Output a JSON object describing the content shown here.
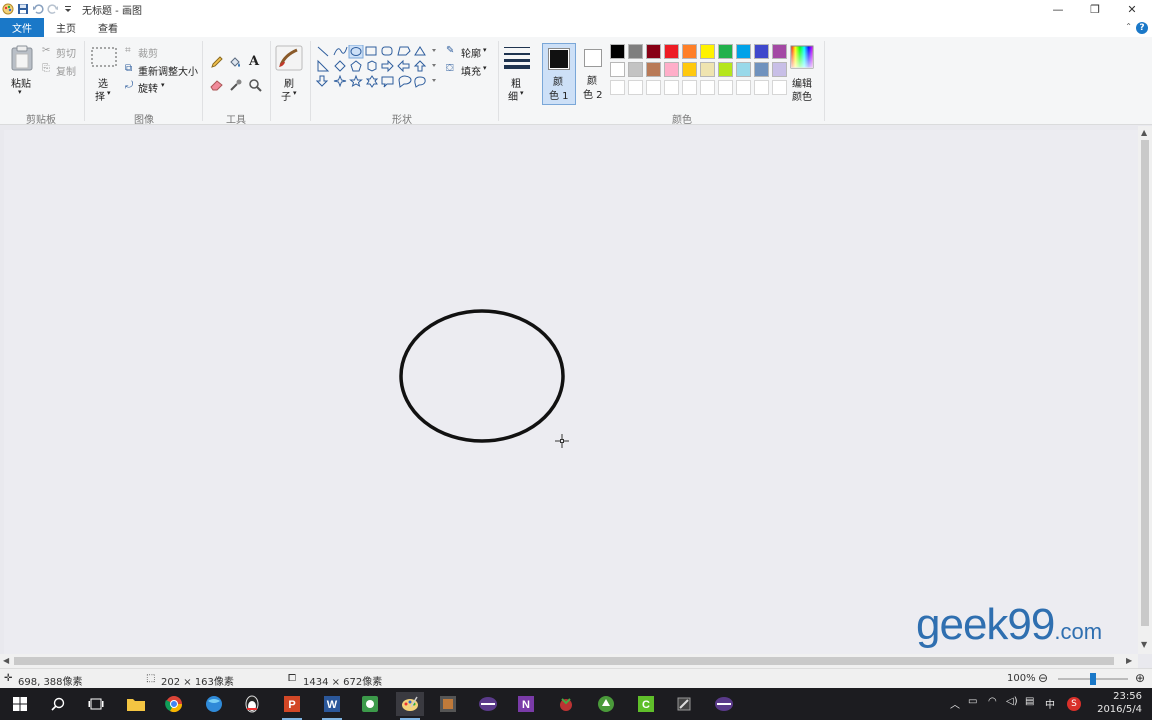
{
  "window": {
    "title": "无标题 - 画图"
  },
  "tabs": [
    {
      "label": "文件"
    },
    {
      "label": "主页"
    },
    {
      "label": "查看"
    }
  ],
  "ribbon": {
    "clipboard": {
      "group_label": "剪贴板",
      "paste_label": "粘贴",
      "cut_label": "剪切",
      "copy_label": "复制"
    },
    "image": {
      "group_label": "图像",
      "select_label_1": "选",
      "select_label_2": "择",
      "crop_label": "裁剪",
      "resize_label": "重新调整大小",
      "rotate_label": "旋转"
    },
    "tools": {
      "group_label": "工具"
    },
    "brushes": {
      "label_1": "刷",
      "label_2": "子"
    },
    "shapes": {
      "group_label": "形状",
      "outline_label": "轮廓",
      "fill_label": "填充"
    },
    "size": {
      "label_1": "粗",
      "label_2": "细"
    },
    "colors": {
      "group_label": "颜色",
      "color1_label_1": "颜",
      "color1_label_2": "色 1",
      "color2_label_1": "颜",
      "color2_label_2": "色 2",
      "edit_label_1": "编辑",
      "edit_label_2": "颜色",
      "color1_value": "#111111",
      "color2_value": "#ffffff",
      "palette_row1": [
        "#000000",
        "#7f7f7f",
        "#880015",
        "#ed1c24",
        "#ff7f27",
        "#fff200",
        "#22b14c",
        "#00a2e8",
        "#3f48cc",
        "#a349a4"
      ],
      "palette_row2": [
        "#ffffff",
        "#c3c3c3",
        "#b97a57",
        "#ffaec9",
        "#ffc90e",
        "#efe4b0",
        "#b5e61d",
        "#99d9ea",
        "#7092be",
        "#c8bfe7"
      ],
      "palette_row3": [
        "#ffffff",
        "#ffffff",
        "#ffffff",
        "#ffffff",
        "#ffffff",
        "#ffffff",
        "#ffffff",
        "#ffffff",
        "#ffffff",
        "#ffffff"
      ]
    }
  },
  "canvas": {
    "background": "#ececf1",
    "shape": "ellipse",
    "stroke_color": "#111111"
  },
  "watermark": {
    "main": "geek99",
    "domain": ".com"
  },
  "status": {
    "cursor_pos": "698, 388像素",
    "selection_size": "202 × 163像素",
    "image_size": "1434 × 672像素",
    "zoom": "100%",
    "zoom_level": 1.0
  },
  "taskbar": {
    "ime": "中",
    "time": "23:56",
    "date": "2016/5/4"
  }
}
